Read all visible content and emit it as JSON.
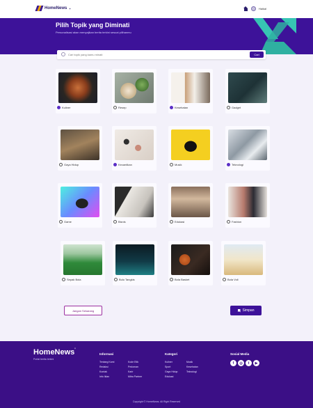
{
  "brand": {
    "name": "HomeNews",
    "badge": "+"
  },
  "nav": {
    "user_label": "Haikal"
  },
  "hero": {
    "title": "Pilih Topik yang Diminati",
    "subtitle": "Personalisasi akan menyajikan berita terkini sesuai pilihanmu"
  },
  "search": {
    "placeholder": "Cari topik yang kamu minati",
    "button": "Cari"
  },
  "topics": [
    {
      "label": "Kuliner",
      "selected": true
    },
    {
      "label": "Resep",
      "selected": false
    },
    {
      "label": "Kesehatan",
      "selected": true
    },
    {
      "label": "Gadget",
      "selected": false
    },
    {
      "label": "Gaya Hidup",
      "selected": false
    },
    {
      "label": "Kecantikan",
      "selected": true
    },
    {
      "label": "Musik",
      "selected": false
    },
    {
      "label": "Teknologi",
      "selected": true
    },
    {
      "label": "Game",
      "selected": false
    },
    {
      "label": "Bisnis",
      "selected": false
    },
    {
      "label": "Edukasi",
      "selected": false
    },
    {
      "label": "Fashion",
      "selected": false
    },
    {
      "label": "Sepak Bola",
      "selected": false
    },
    {
      "label": "Bulu Tangkis",
      "selected": false
    },
    {
      "label": "Bola Basket",
      "selected": false
    },
    {
      "label": "Bola Voli",
      "selected": false
    }
  ],
  "actions": {
    "reset": "Jangan Sekarang",
    "save": "Simpan"
  },
  "footer": {
    "brand": "HomeNews",
    "badge": "'",
    "tagline": "Portal berita terkini",
    "info_title": "Informasi",
    "info_links": [
      "Tentang Kami",
      "Redaksi",
      "Kontak",
      "Info Iklan",
      "Kode Etik",
      "Pedoman",
      "Karir",
      "Mitra Partner"
    ],
    "category_title": "Kategori",
    "category_links": [
      "Kuliner",
      "Sport",
      "Gaya Hidup",
      "Edukasi",
      "Musik",
      "Kesehatan",
      "Teknologi"
    ],
    "social_title": "Sosial Media",
    "social_icons": [
      "facebook-icon",
      "instagram-icon",
      "twitter-icon",
      "youtube-icon"
    ],
    "copyright": "Copyright © HomeNews. All Right Reserved"
  },
  "colors": {
    "primary": "#3d1299",
    "accent": "#37c4b3",
    "background": "#f3f1fa"
  }
}
